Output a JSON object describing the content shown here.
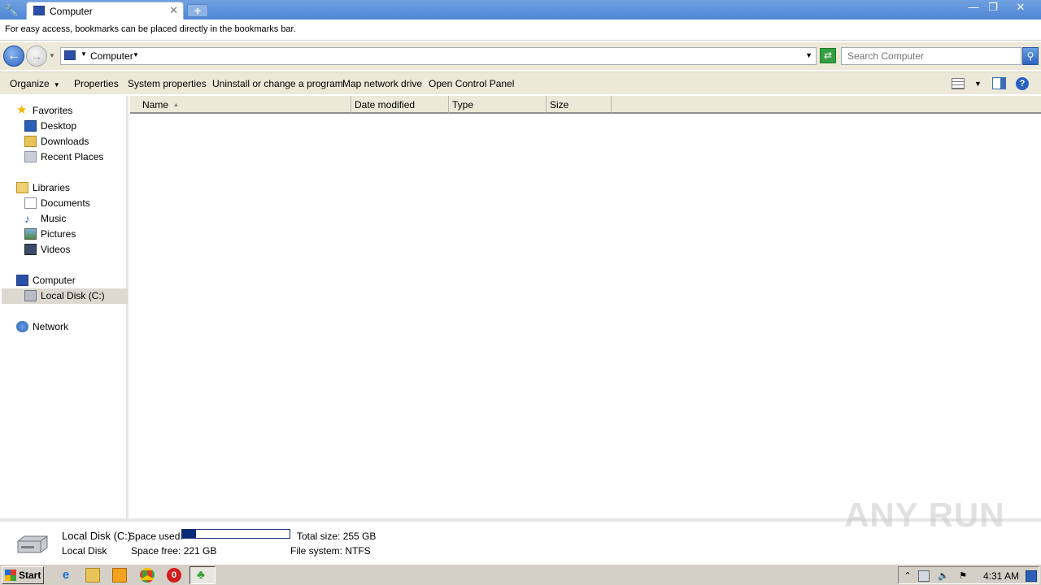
{
  "browser": {
    "tab_title": "Computer",
    "bookmarks_hint": "For easy access, bookmarks can be placed directly in the bookmarks bar."
  },
  "address": {
    "location": "Computer",
    "search_placeholder": "Search Computer"
  },
  "commands": {
    "organize": "Organize",
    "properties": "Properties",
    "system_properties": "System properties",
    "uninstall": "Uninstall or change a program",
    "map_drive": "Map network drive",
    "control_panel": "Open Control Panel"
  },
  "nav": {
    "favorites": "Favorites",
    "desktop": "Desktop",
    "downloads": "Downloads",
    "recent": "Recent Places",
    "libraries": "Libraries",
    "documents": "Documents",
    "music": "Music",
    "pictures": "Pictures",
    "videos": "Videos",
    "computer": "Computer",
    "local_disk": "Local Disk (C:)",
    "network": "Network"
  },
  "columns": {
    "name": "Name",
    "date": "Date modified",
    "type": "Type",
    "size": "Size"
  },
  "details": {
    "title": "Local Disk (C:)",
    "subtitle": "Local Disk",
    "space_used_label": "Space used:",
    "space_used_fraction": 0.13,
    "total_size": "Total size:  255 GB",
    "space_free": "Space free:  221 GB",
    "file_system": "File system:  NTFS"
  },
  "taskbar": {
    "start": "Start",
    "clock": "4:31 AM"
  },
  "watermark": "ANY RUN"
}
